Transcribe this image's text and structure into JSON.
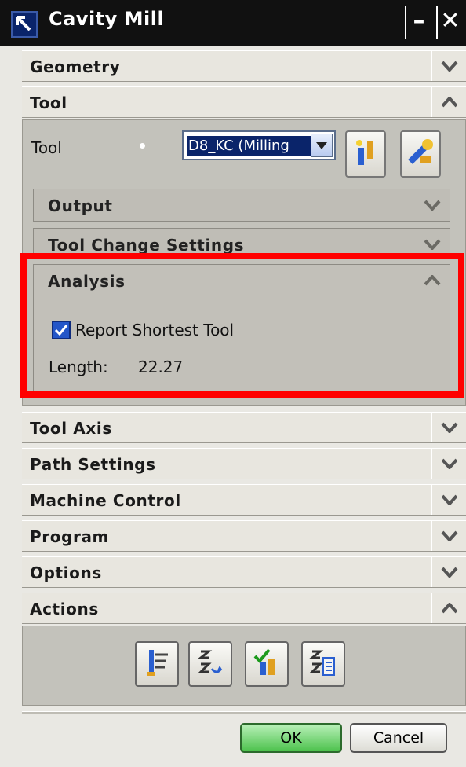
{
  "window": {
    "title": "Cavity Mill",
    "minimize": "–",
    "close": "✕"
  },
  "sections": {
    "geometry": "Geometry",
    "tool": "Tool",
    "tool_axis": "Tool Axis",
    "path_settings": "Path Settings",
    "machine_control": "Machine Control",
    "program": "Program",
    "options": "Options",
    "actions": "Actions"
  },
  "tool_panel": {
    "tool_label": "Tool",
    "tool_select_value": "D8_KC (Milling",
    "subsections": {
      "output": "Output",
      "tool_change": "Tool Change Settings",
      "analysis": "Analysis"
    },
    "analysis": {
      "report_label": "Report Shortest Tool",
      "report_checked": true,
      "length_label": "Length:",
      "length_value": "22.27"
    }
  },
  "icons": {
    "title": "cursor-arrow-icon",
    "new_tool": "new-tool-icon",
    "edit_tool": "edit-tool-icon",
    "generate": "generate-toolpath-icon",
    "replay": "replay-icon",
    "verify": "verify-icon",
    "list": "list-icon"
  },
  "colors": {
    "highlight": "#ff0000",
    "panel": "#c3c2bb",
    "ok": "#4dc24d"
  },
  "footer": {
    "ok": "OK",
    "cancel": "Cancel"
  }
}
